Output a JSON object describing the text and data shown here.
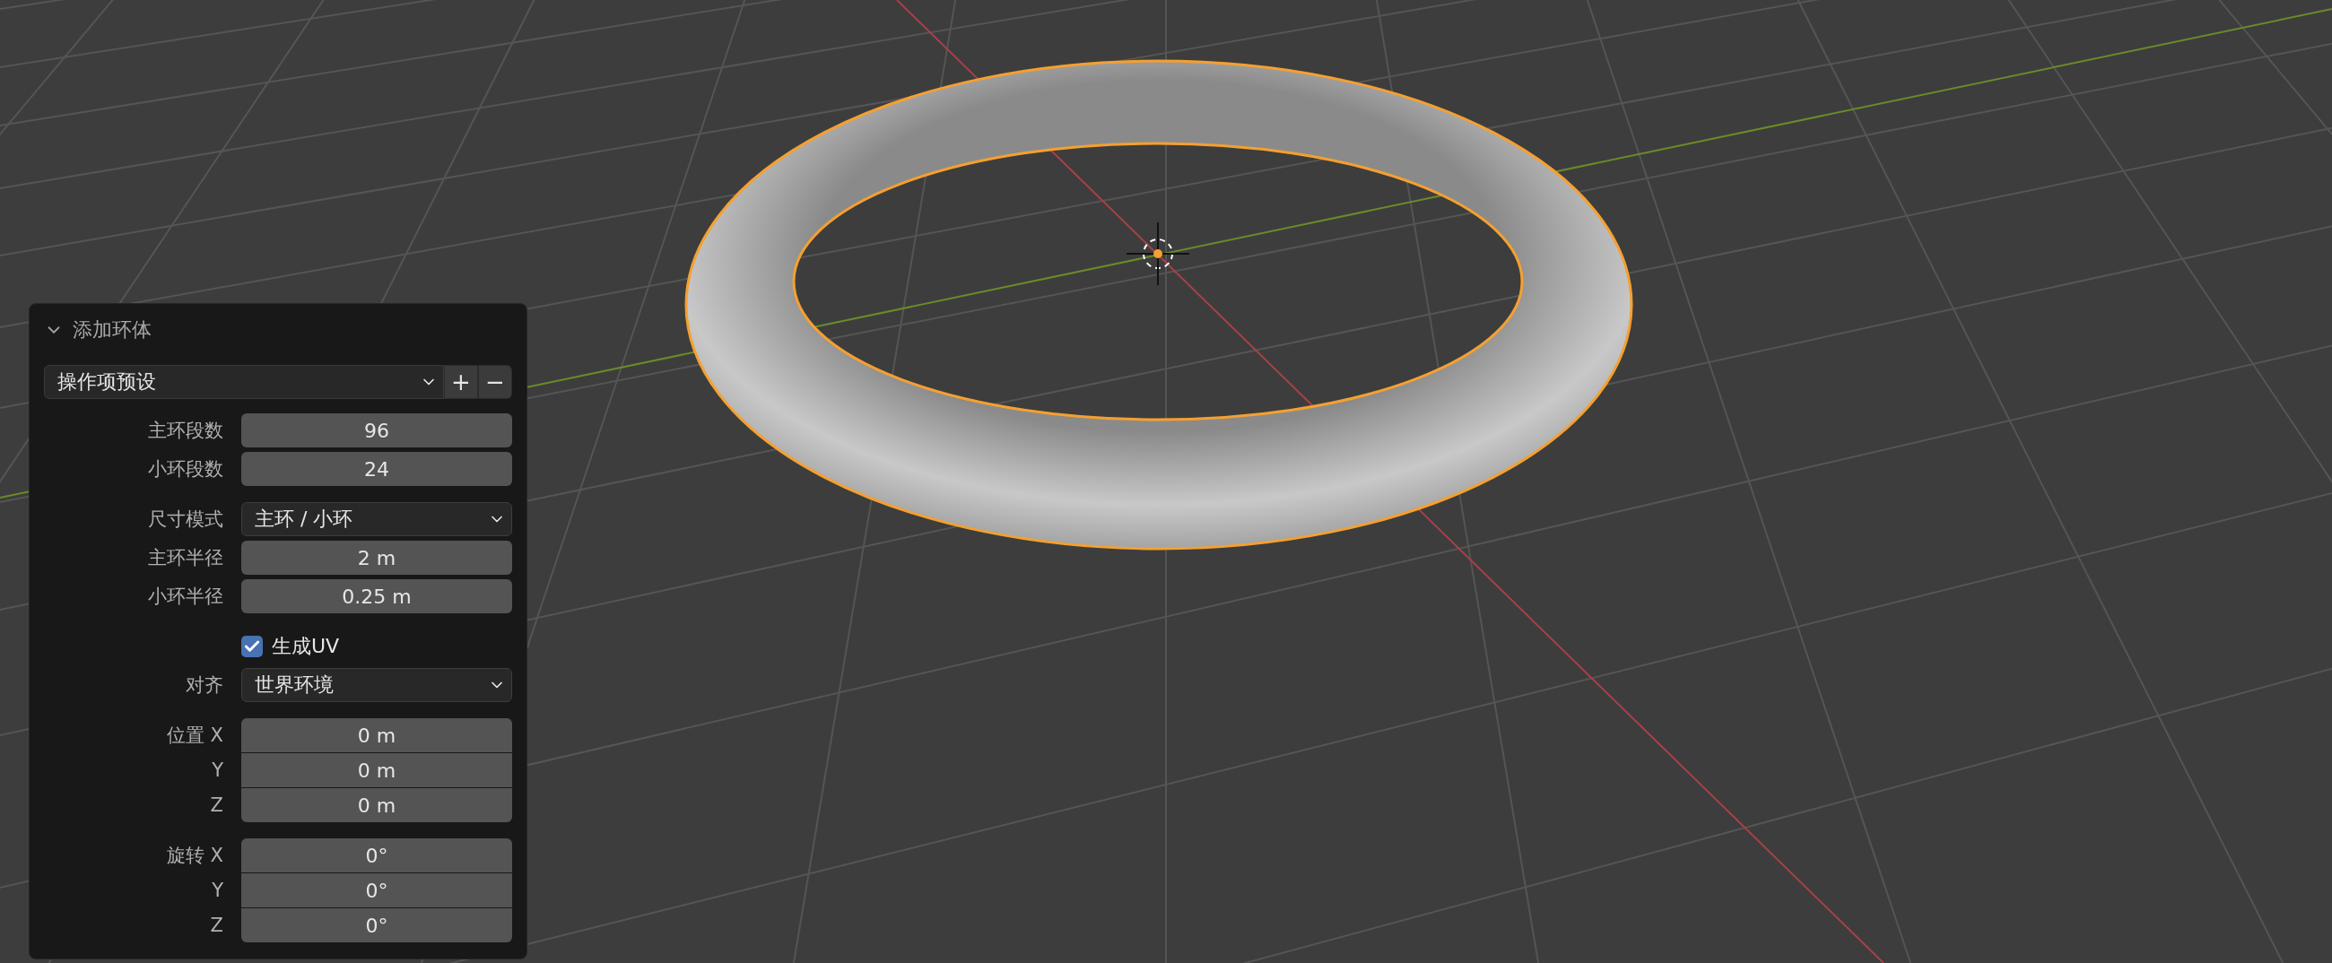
{
  "panel": {
    "title": "添加环体",
    "expanded": true,
    "preset": {
      "label": "操作项预设",
      "add": "+",
      "remove": "−"
    },
    "groups": [
      {
        "joined": false,
        "rows": [
          {
            "kind": "number",
            "label": "主环段数",
            "value": "96"
          },
          {
            "kind": "number",
            "label": "小环段数",
            "value": "24"
          }
        ]
      },
      {
        "joined": false,
        "rows": [
          {
            "kind": "dropdown",
            "label": "尺寸模式",
            "value": "主环 / 小环"
          },
          {
            "kind": "number",
            "label": "主环半径",
            "value": "2 m"
          },
          {
            "kind": "number",
            "label": "小环半径",
            "value": "0.25 m"
          }
        ]
      },
      {
        "joined": false,
        "rows": [
          {
            "kind": "checkbox",
            "label": "生成UV",
            "checked": true
          },
          {
            "kind": "dropdown",
            "label": "对齐",
            "value": "世界环境"
          }
        ]
      },
      {
        "joined": true,
        "rows": [
          {
            "kind": "number",
            "label": "位置 X",
            "value": "0 m"
          },
          {
            "kind": "number",
            "label": "Y",
            "value": "0 m"
          },
          {
            "kind": "number",
            "label": "Z",
            "value": "0 m"
          }
        ]
      },
      {
        "joined": true,
        "rows": [
          {
            "kind": "number",
            "label": "旋转 X",
            "value": "0°"
          },
          {
            "kind": "number",
            "label": "Y",
            "value": "0°"
          },
          {
            "kind": "number",
            "label": "Z",
            "value": "0°"
          }
        ]
      }
    ]
  }
}
